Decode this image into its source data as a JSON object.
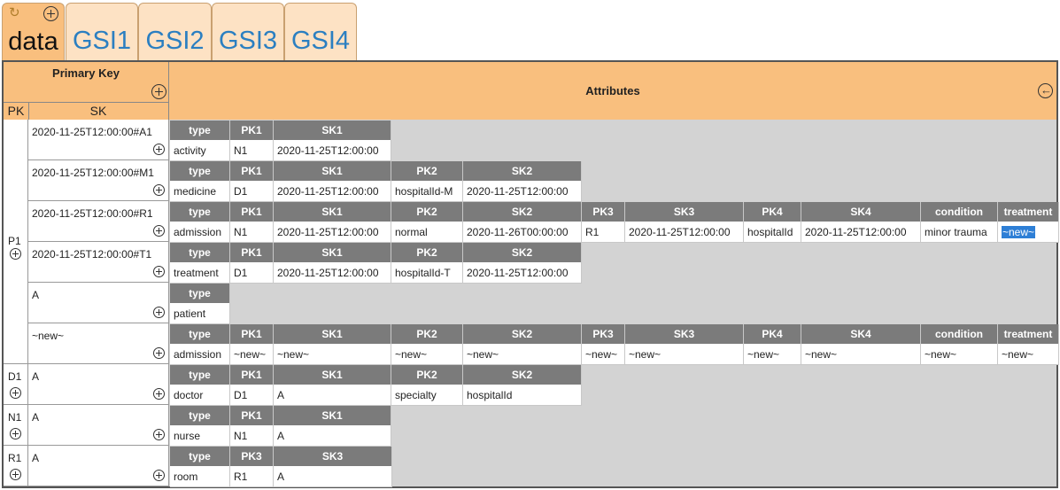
{
  "tabs": [
    {
      "label": "data",
      "active": true
    },
    {
      "label": "GSI1"
    },
    {
      "label": "GSI2"
    },
    {
      "label": "GSI3"
    },
    {
      "label": "GSI4"
    }
  ],
  "header": {
    "primary_key": "Primary Key",
    "pk": "PK",
    "sk": "SK",
    "attributes": "Attributes"
  },
  "icons": {
    "sync": "sync-icon",
    "add": "add-circle-icon",
    "back": "back-arrow-circle-icon"
  },
  "colors": {
    "header_bg": "#f9bf7e",
    "tab_inactive": "#fde2c4",
    "attr_header_bg": "#7b7b7b",
    "selection": "#2e7fd6",
    "tab_text": "#2b7fc1"
  },
  "partitions": [
    {
      "pk": "P1",
      "rows": [
        {
          "sk": "2020-11-25T12:00:00#A1",
          "headers": [
            "type",
            "PK1",
            "SK1"
          ],
          "values": [
            "activity",
            "N1",
            "2020-11-25T12:00:00"
          ]
        },
        {
          "sk": "2020-11-25T12:00:00#M1",
          "headers": [
            "type",
            "PK1",
            "SK1",
            "PK2",
            "SK2"
          ],
          "values": [
            "medicine",
            "D1",
            "2020-11-25T12:00:00",
            "hospitalId-M",
            "2020-11-25T12:00:00"
          ]
        },
        {
          "sk": "2020-11-25T12:00:00#R1",
          "headers": [
            "type",
            "PK1",
            "SK1",
            "PK2",
            "SK2",
            "PK3",
            "SK3",
            "PK4",
            "SK4",
            "condition",
            "treatment"
          ],
          "values": [
            "admission",
            "N1",
            "2020-11-25T12:00:00",
            "normal",
            "2020-11-26T00:00:00",
            "R1",
            "2020-11-25T12:00:00",
            "hospitalId",
            "2020-11-25T12:00:00",
            "minor trauma",
            "~new~"
          ]
        },
        {
          "sk": "2020-11-25T12:00:00#T1",
          "headers": [
            "type",
            "PK1",
            "SK1",
            "PK2",
            "SK2"
          ],
          "values": [
            "treatment",
            "D1",
            "2020-11-25T12:00:00",
            "hospitalId-T",
            "2020-11-25T12:00:00"
          ]
        },
        {
          "sk": "A",
          "headers": [
            "type"
          ],
          "values": [
            "patient"
          ]
        },
        {
          "sk": "~new~",
          "headers": [
            "type",
            "PK1",
            "SK1",
            "PK2",
            "SK2",
            "PK3",
            "SK3",
            "PK4",
            "SK4",
            "condition",
            "treatment"
          ],
          "values": [
            "admission",
            "~new~",
            "~new~",
            "~new~",
            "~new~",
            "~new~",
            "~new~",
            "~new~",
            "~new~",
            "~new~",
            "~new~"
          ]
        }
      ]
    },
    {
      "pk": "D1",
      "rows": [
        {
          "sk": "A",
          "headers": [
            "type",
            "PK1",
            "SK1",
            "PK2",
            "SK2"
          ],
          "values": [
            "doctor",
            "D1",
            "A",
            "specialty",
            "hospitalId"
          ]
        }
      ]
    },
    {
      "pk": "N1",
      "rows": [
        {
          "sk": "A",
          "headers": [
            "type",
            "PK1",
            "SK1"
          ],
          "values": [
            "nurse",
            "N1",
            "A"
          ]
        }
      ]
    },
    {
      "pk": "R1",
      "rows": [
        {
          "sk": "A",
          "headers": [
            "type",
            "PK3",
            "SK3"
          ],
          "values": [
            "room",
            "R1",
            "A"
          ]
        }
      ]
    }
  ]
}
